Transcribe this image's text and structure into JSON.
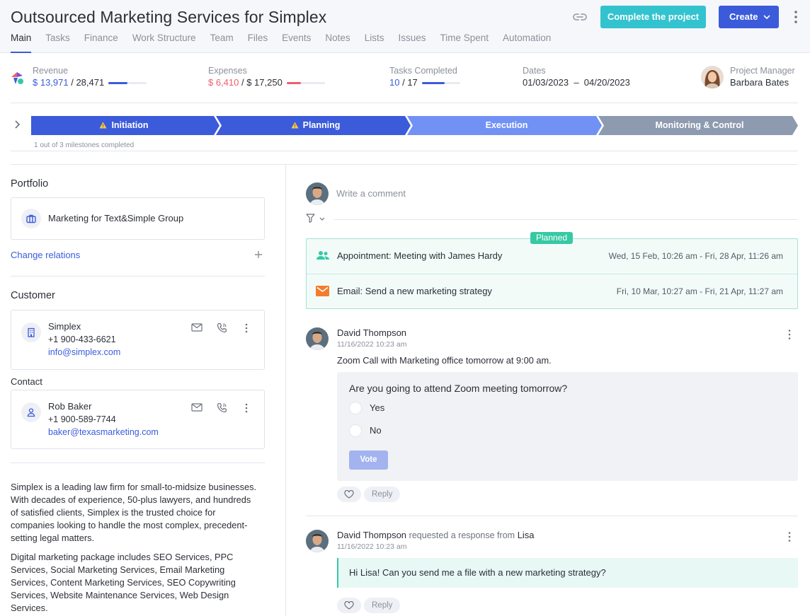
{
  "header": {
    "title": "Outsourced Marketing Services for Simplex",
    "tabs": [
      "Main",
      "Tasks",
      "Finance",
      "Work Structure",
      "Team",
      "Files",
      "Events",
      "Notes",
      "Lists",
      "Issues",
      "Time Spent",
      "Automation"
    ],
    "active_tab": "Main",
    "complete_label": "Complete the project",
    "create_label": "Create"
  },
  "stats": {
    "revenue": {
      "label": "Revenue",
      "value": "$ 13,971",
      "total": "28,471",
      "progress": 0.49
    },
    "expenses": {
      "label": "Expenses",
      "value": "$ 6,410",
      "total": "$ 17,250",
      "progress": 0.37
    },
    "tasks": {
      "label": "Tasks Completed",
      "value": "10",
      "total": "17",
      "progress": 0.59
    },
    "dates": {
      "label": "Dates",
      "start": "01/03/2023",
      "separator": "–",
      "end": "04/20/2023"
    },
    "manager": {
      "label": "Project Manager",
      "name": "Barbara Bates"
    }
  },
  "stages": {
    "items": [
      {
        "label": "Initiation",
        "warning": true
      },
      {
        "label": "Planning",
        "warning": true
      },
      {
        "label": "Execution",
        "warning": false
      },
      {
        "label": "Monitoring & Control",
        "warning": false
      }
    ],
    "milestones_text": "1 out of 3 milestones completed",
    "colors": {
      "done": "#3b5bdb",
      "current": "#7191f5",
      "future": "#8d9aaf"
    }
  },
  "portfolio": {
    "title": "Portfolio",
    "name": "Marketing for Text&Simple Group",
    "change_relations": "Change relations"
  },
  "customer": {
    "title": "Customer",
    "name": "Simplex",
    "phone": "+1 900-433-6621",
    "email": "info@simplex.com"
  },
  "contact": {
    "title": "Contact",
    "name": "Rob Baker",
    "phone": "+1 900-589-7744",
    "email": "baker@texasmarketing.com"
  },
  "description": {
    "p1": "Simplex is a leading law firm for small-to-midsize businesses. With decades of experience, 50-plus lawyers, and hundreds of satisfied clients, Simplex is the trusted choice for companies looking to handle the most complex, precedent-setting legal matters.",
    "p2": "Digital marketing package includes SEO Services, PPC Services, Social Marketing Services, Email Marketing Services, Content Marketing Services, SEO Copywriting Services, Website Maintenance Services, Web Design Services."
  },
  "feed": {
    "comment_placeholder": "Write a comment",
    "planned_badge": "Planned",
    "planned": [
      {
        "icon": "group-icon",
        "title": "Appointment: Meeting with James Hardy",
        "dates": "Wed, 15 Feb, 10:26 am - Fri, 28 Apr, 11:26 am"
      },
      {
        "icon": "email-icon",
        "title": "Email: Send a new marketing strategy",
        "dates": "Fri, 10 Mar, 10:27 am - Fri, 21 Apr, 11:27 am"
      }
    ],
    "comments": [
      {
        "author": "David Thompson",
        "time": "11/16/2022 10:23 am",
        "text": "Zoom Call with Marketing office tomorrow at 9:00 am.",
        "poll": {
          "question": "Are you going to attend Zoom meeting tomorrow?",
          "options": [
            "Yes",
            "No"
          ],
          "vote_label": "Vote"
        },
        "reply_label": "Reply"
      },
      {
        "author": "David Thompson",
        "action": "requested a response from",
        "target": "Lisa",
        "time": "11/16/2022 10:23 am",
        "quote": "Hi Lisa! Can you send me a file with a new marketing strategy?",
        "reply_label": "Reply"
      }
    ]
  }
}
